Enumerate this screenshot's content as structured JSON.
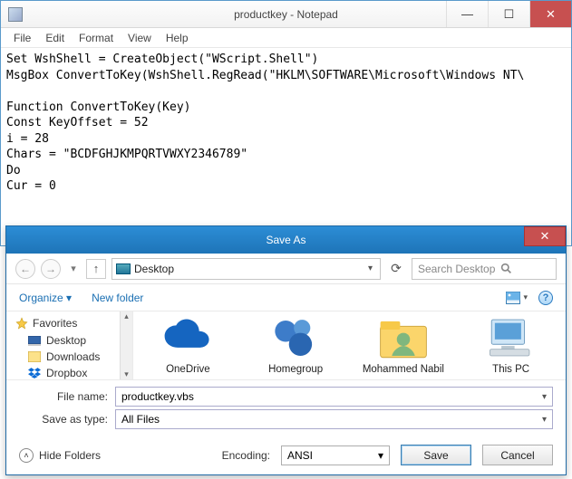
{
  "notepad": {
    "title": "productkey - Notepad",
    "menu": [
      "File",
      "Edit",
      "Format",
      "View",
      "Help"
    ],
    "content": "Set WshShell = CreateObject(\"WScript.Shell\")\nMsgBox ConvertToKey(WshShell.RegRead(\"HKLM\\SOFTWARE\\Microsoft\\Windows NT\\\n\nFunction ConvertToKey(Key)\nConst KeyOffset = 52\ni = 28\nChars = \"BCDFGHJKMPQRTVWXY2346789\"\nDo\nCur = 0"
  },
  "saveAs": {
    "title": "Save As",
    "path": "Desktop",
    "searchPlaceholder": "Search Desktop",
    "organize": "Organize",
    "newFolder": "New folder",
    "sidebar": {
      "header": "Favorites",
      "items": [
        "Desktop",
        "Downloads",
        "Dropbox"
      ]
    },
    "content": [
      {
        "name": "OneDrive"
      },
      {
        "name": "Homegroup"
      },
      {
        "name": "Mohammed Nabil"
      },
      {
        "name": "This PC"
      }
    ],
    "fileNameLabel": "File name:",
    "fileName": "productkey.vbs",
    "saveTypeLabel": "Save as type:",
    "saveType": "All Files",
    "hideFolders": "Hide Folders",
    "encodingLabel": "Encoding:",
    "encoding": "ANSI",
    "save": "Save",
    "cancel": "Cancel"
  }
}
